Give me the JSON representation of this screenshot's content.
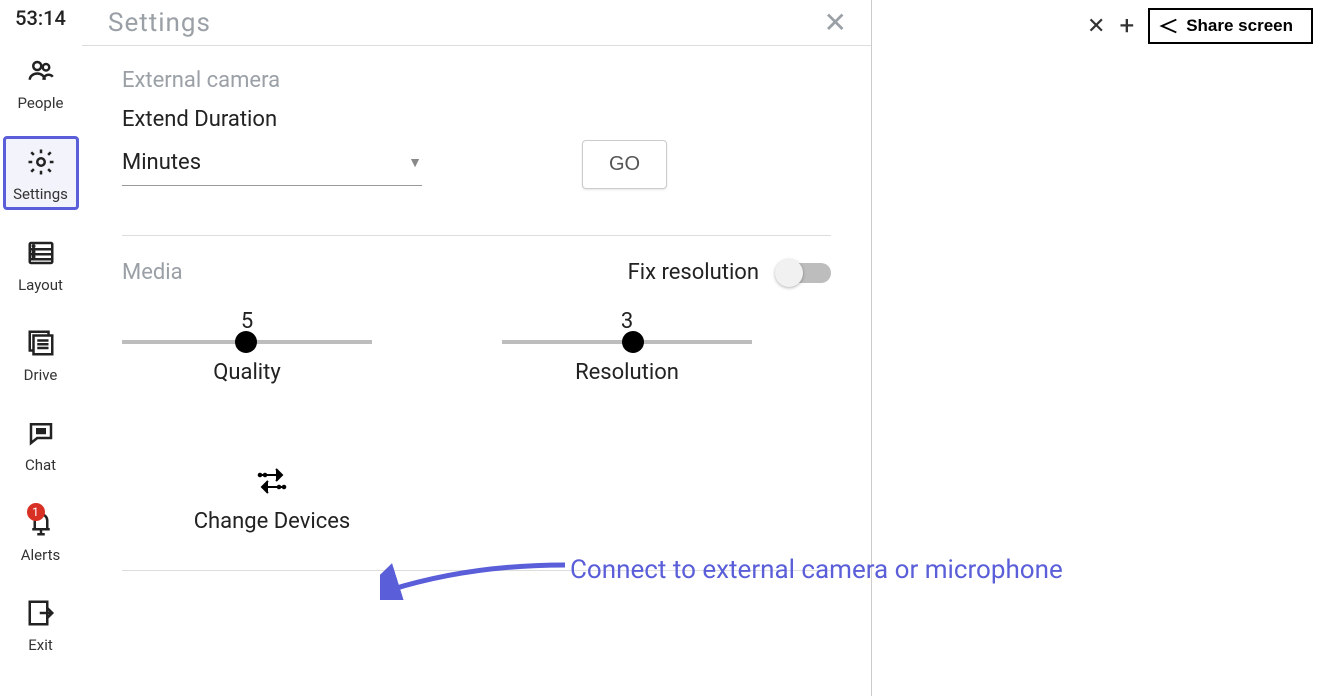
{
  "timer": "53:14",
  "sidebar": {
    "items": [
      {
        "id": "people",
        "label": "People"
      },
      {
        "id": "settings",
        "label": "Settings"
      },
      {
        "id": "layout",
        "label": "Layout"
      },
      {
        "id": "drive",
        "label": "Drive"
      },
      {
        "id": "chat",
        "label": "Chat"
      },
      {
        "id": "alerts",
        "label": "Alerts",
        "badge": "1"
      },
      {
        "id": "exit",
        "label": "Exit"
      }
    ],
    "selected": "settings"
  },
  "panel": {
    "title": "Settings",
    "external_camera": {
      "section_label": "External camera",
      "extend_label": "Extend Duration",
      "select_value": "Minutes",
      "go_label": "GO"
    },
    "media": {
      "section_label": "Media",
      "fix_label": "Fix resolution",
      "fix_on": false,
      "quality": {
        "value": "5",
        "label": "Quality",
        "percent": 45
      },
      "resolution": {
        "value": "3",
        "label": "Resolution",
        "percent": 48
      }
    },
    "change_devices_label": "Change Devices"
  },
  "topbar": {
    "share_label": "Share screen"
  },
  "annotation": {
    "text": "Connect to external camera or microphone"
  }
}
